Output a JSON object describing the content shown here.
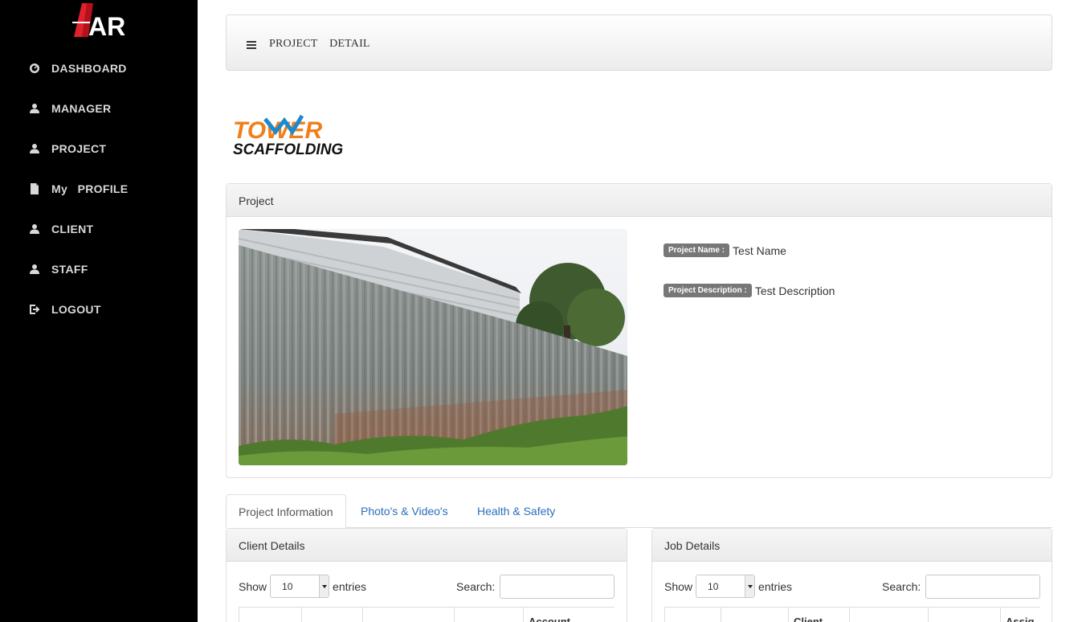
{
  "brand": {
    "logo_text": "AR"
  },
  "sidebar": {
    "items": [
      {
        "label": "DASHBOARD",
        "icon": "dashboard-icon"
      },
      {
        "label": "MANAGER",
        "icon": "user-icon"
      },
      {
        "label": "PROJECT",
        "icon": "user-icon"
      },
      {
        "label": "My   PROFILE",
        "icon": "file-icon"
      },
      {
        "label": "CLIENT",
        "icon": "user-icon"
      },
      {
        "label": "STAFF",
        "icon": "user-icon"
      },
      {
        "label": "LOGOUT",
        "icon": "logout-icon"
      }
    ]
  },
  "header": {
    "title": "PROJECT    DETAIL"
  },
  "company": {
    "logo_line1": "TOWER",
    "logo_line2": "SCAFFOLDING"
  },
  "project": {
    "heading": "Project",
    "name_label": "Project Name :",
    "name_value": "Test Name",
    "description_label": "Project Description :",
    "description_value": "Test Description"
  },
  "tabs": [
    {
      "label": "Project Information",
      "active": true
    },
    {
      "label": "Photo's & Video's",
      "active": false
    },
    {
      "label": "Health & Safety",
      "active": false
    }
  ],
  "client_details": {
    "heading": "Client Details",
    "show_label": "Show",
    "entries_value": "10",
    "entries_label": "entries",
    "search_label": "Search:",
    "columns": [
      "",
      "",
      "",
      "",
      "Account"
    ]
  },
  "job_details": {
    "heading": "Job Details",
    "show_label": "Show",
    "entries_value": "10",
    "entries_label": "entries",
    "search_label": "Search:",
    "columns": [
      "",
      "",
      "Client",
      "",
      "",
      "Assig"
    ]
  },
  "colors": {
    "sidebar_bg": "#000000",
    "logo_red": "#e0202a",
    "company_orange": "#f07f1a",
    "company_blue": "#1b8ad0",
    "badge_gray": "#777777",
    "link_blue": "#2a6ebb"
  }
}
